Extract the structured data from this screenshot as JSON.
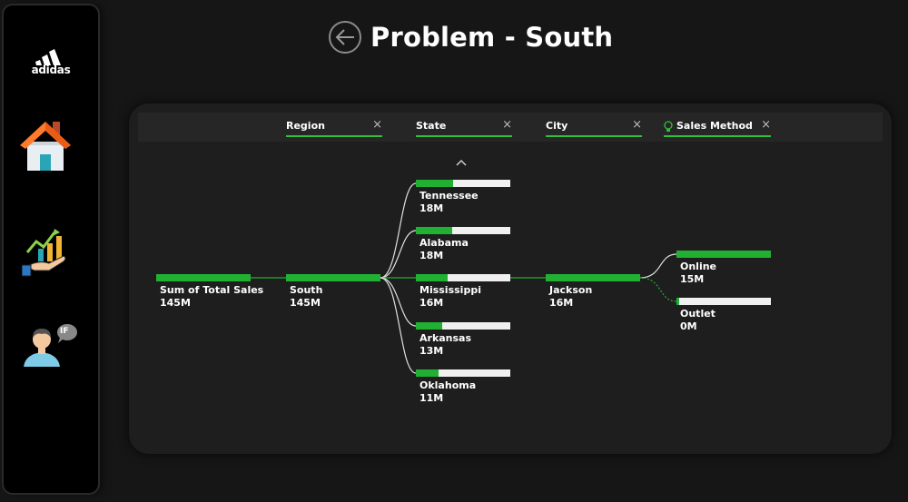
{
  "header": {
    "title": "Problem - South",
    "back_icon": "arrow-left-circle-icon"
  },
  "sidebar": {
    "logo_text": "adidas",
    "items": [
      {
        "icon": "home-icon"
      },
      {
        "icon": "sales-growth-icon"
      },
      {
        "icon": "person-if-icon",
        "badge": "IF"
      }
    ]
  },
  "levels": [
    {
      "label": "Region"
    },
    {
      "label": "State"
    },
    {
      "label": "City"
    },
    {
      "label": "Sales Method",
      "icon": "lightbulb-icon"
    }
  ],
  "tree": {
    "root": {
      "name": "Sum of Total Sales",
      "value": "145M"
    },
    "region": {
      "name": "South",
      "value": "145M"
    },
    "states": [
      {
        "name": "Tennessee",
        "value": "18M"
      },
      {
        "name": "Alabama",
        "value": "18M"
      },
      {
        "name": "Mississippi",
        "value": "16M"
      },
      {
        "name": "Arkansas",
        "value": "13M"
      },
      {
        "name": "Oklahoma",
        "value": "11M"
      }
    ],
    "city": {
      "name": "Jackson",
      "value": "16M"
    },
    "methods": [
      {
        "name": "Online",
        "value": "15M"
      },
      {
        "name": "Outlet",
        "value": "0M"
      }
    ]
  },
  "colors": {
    "accent": "#22b033",
    "bar_bg": "#f0f0f0",
    "panel": "#1e1e1e"
  }
}
